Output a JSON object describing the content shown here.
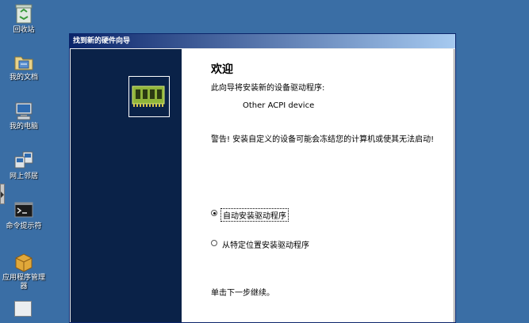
{
  "desktop": {
    "icons": [
      {
        "label": "回收站",
        "icon": "recycle-bin-icon"
      },
      {
        "label": "我的文档",
        "icon": "my-documents-icon"
      },
      {
        "label": "我的电脑",
        "icon": "my-computer-icon"
      },
      {
        "label": "网上邻居",
        "icon": "network-places-icon"
      },
      {
        "label": "命令提示符",
        "icon": "command-prompt-icon"
      },
      {
        "label": "应用程序管理器",
        "icon": "application-manager-icon"
      }
    ]
  },
  "wizard": {
    "title": "找到新的硬件向导",
    "heading": "欢迎",
    "intro": "此向导将安装新的设备驱动程序:",
    "device": "Other ACPI device",
    "warning": "警告! 安装自定义的设备可能会冻结您的计算机或使其无法启动!",
    "options": [
      {
        "label": "自动安装驱动程序",
        "selected": true
      },
      {
        "label": "从特定位置安装驱动程序",
        "selected": false
      }
    ],
    "continue_hint": "单击下一步继续。"
  },
  "colors": {
    "desktop": "#3a6ea5",
    "sidebar": "#0a2248",
    "titlebar": "#0a246a"
  }
}
